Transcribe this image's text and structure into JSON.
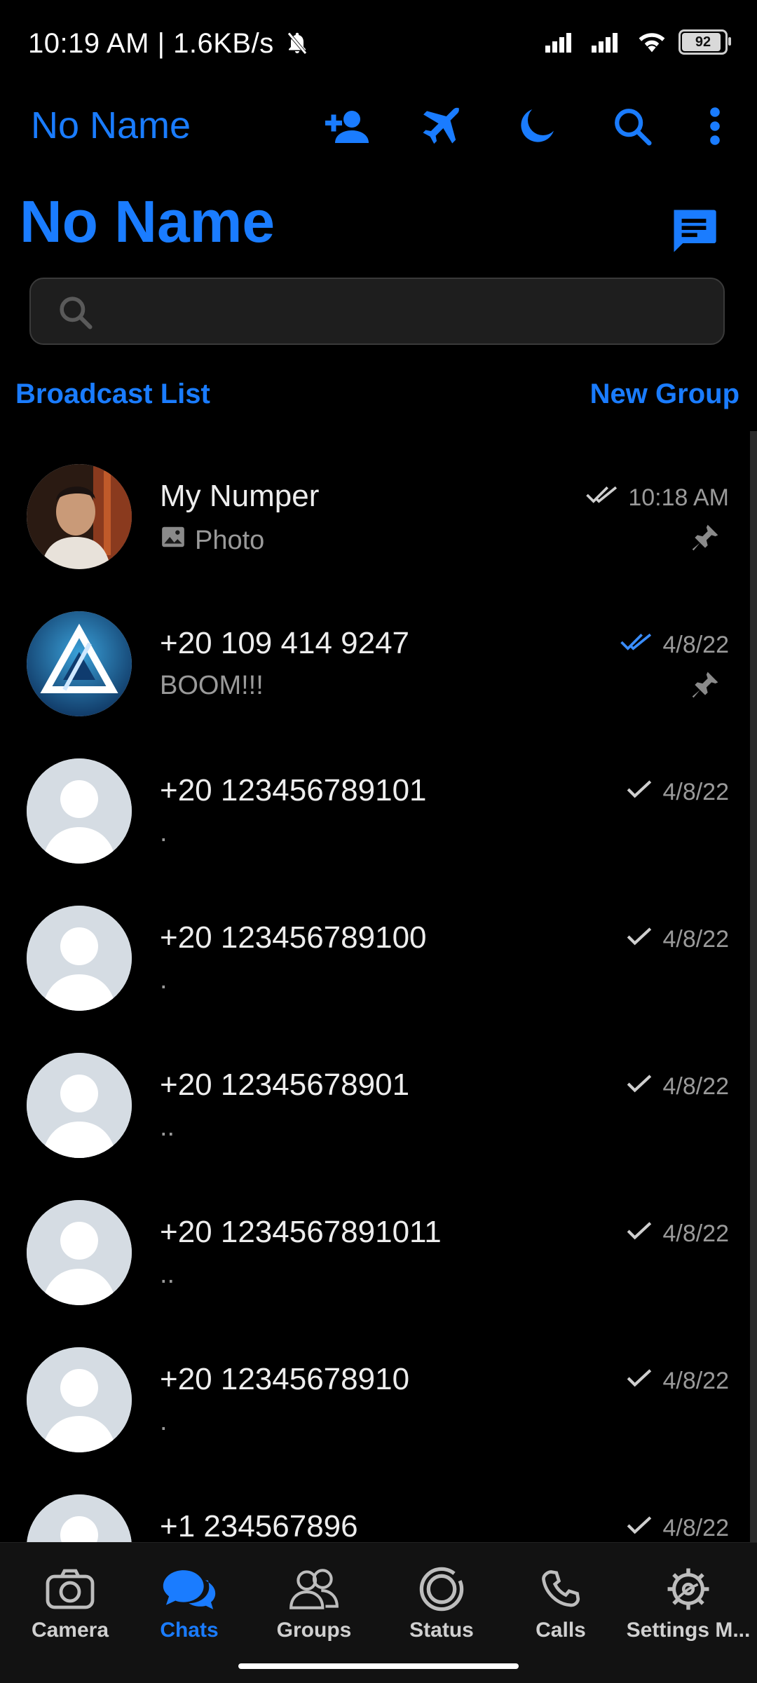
{
  "status_bar": {
    "time": "10:19 AM | 1.6KB/s",
    "battery": "92"
  },
  "app_bar": {
    "title": "No Name"
  },
  "header": {
    "title": "No Name"
  },
  "search": {
    "placeholder": ""
  },
  "links": {
    "broadcast": "Broadcast List",
    "new_group": "New Group"
  },
  "chats": [
    {
      "name": "My Numper",
      "preview": "Photo",
      "time": "10:18 AM",
      "check": "double-grey",
      "pinned": true,
      "avatar": "photo-person"
    },
    {
      "name": "+20 109 414 9247",
      "preview": "BOOM!!!",
      "time": "4/8/22",
      "check": "double-blue",
      "pinned": true,
      "avatar": "logo-triangle"
    },
    {
      "name": "+20 123456789101",
      "preview": ".",
      "time": "4/8/22",
      "check": "single",
      "pinned": false,
      "avatar": "default"
    },
    {
      "name": "+20 123456789100",
      "preview": ".",
      "time": "4/8/22",
      "check": "single",
      "pinned": false,
      "avatar": "default"
    },
    {
      "name": "+20 12345678901",
      "preview": "..",
      "time": "4/8/22",
      "check": "single",
      "pinned": false,
      "avatar": "default"
    },
    {
      "name": "+20 1234567891011",
      "preview": "..",
      "time": "4/8/22",
      "check": "single",
      "pinned": false,
      "avatar": "default"
    },
    {
      "name": "+20 12345678910",
      "preview": ".",
      "time": "4/8/22",
      "check": "single",
      "pinned": false,
      "avatar": "default"
    },
    {
      "name": "+1 234567896",
      "preview": "",
      "time": "4/8/22",
      "check": "single",
      "pinned": false,
      "avatar": "default"
    }
  ],
  "bottom_nav": [
    {
      "label": "Camera",
      "icon": "camera-icon",
      "active": false
    },
    {
      "label": "Chats",
      "icon": "chat-bubbles-icon",
      "active": true
    },
    {
      "label": "Groups",
      "icon": "groups-icon",
      "active": false
    },
    {
      "label": "Status",
      "icon": "status-icon",
      "active": false
    },
    {
      "label": "Calls",
      "icon": "phone-icon",
      "active": false
    },
    {
      "label": "Settings M...",
      "icon": "settings-icon",
      "active": false
    }
  ],
  "colors": {
    "accent": "#1a7cff",
    "background": "#000000",
    "nav_background": "#121212"
  }
}
